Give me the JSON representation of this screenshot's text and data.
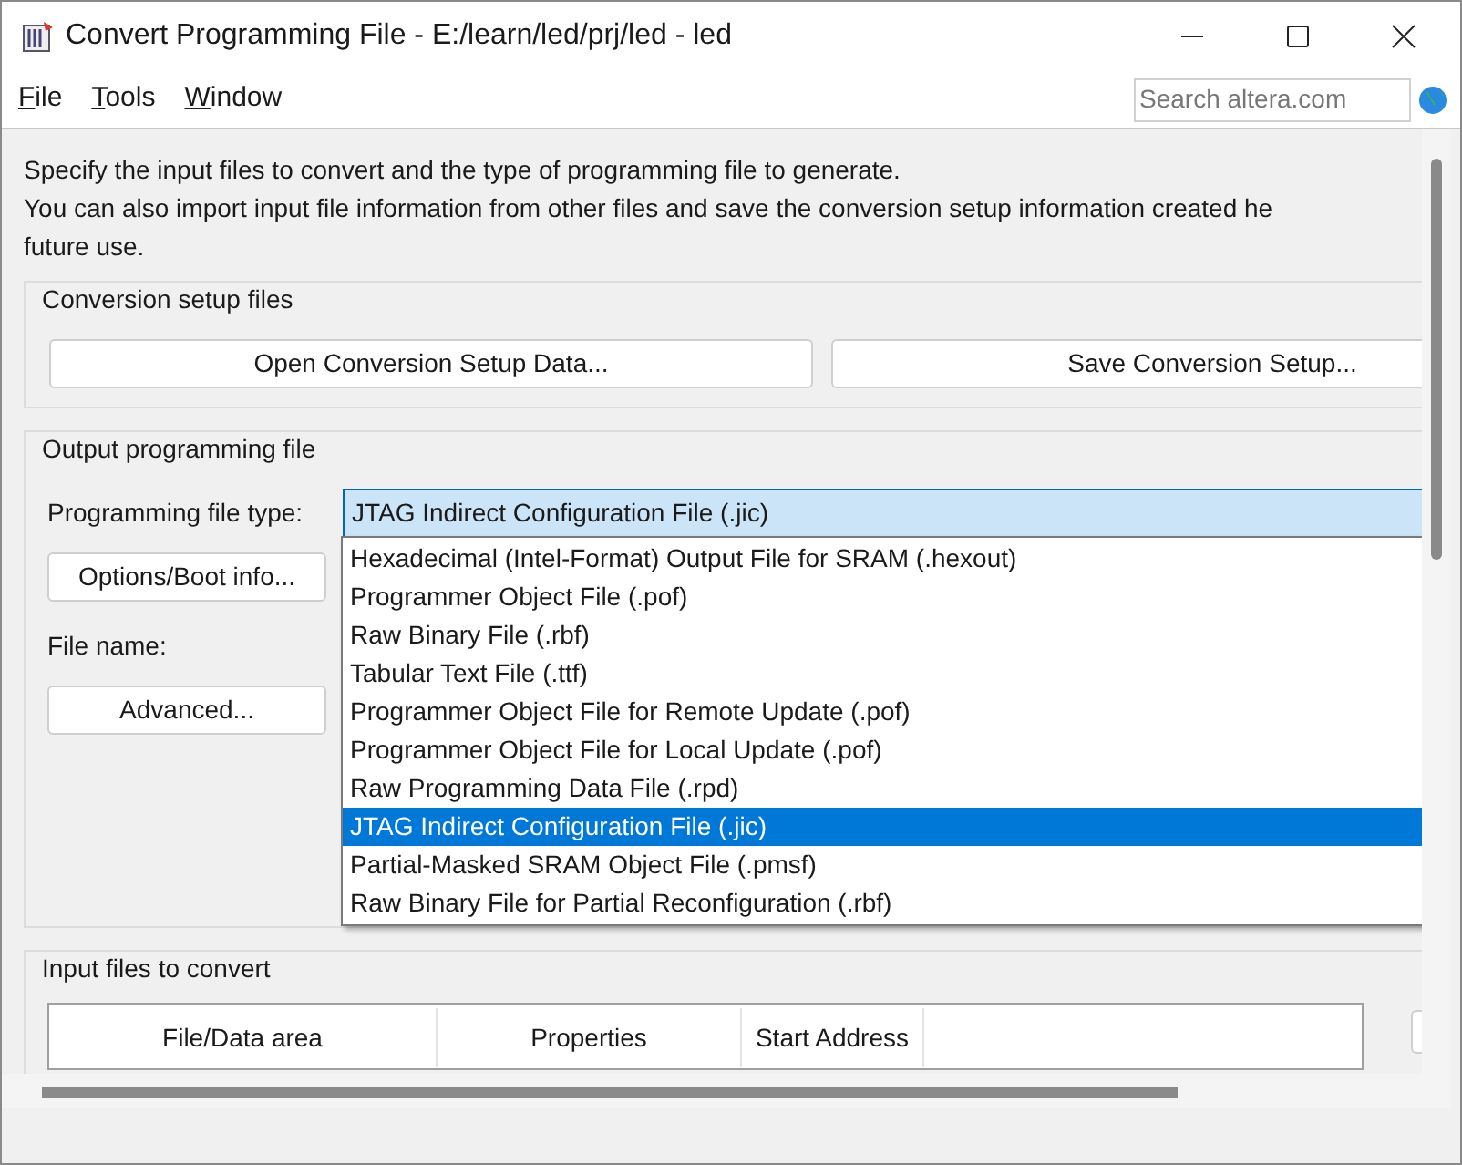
{
  "window": {
    "title": "Convert Programming File - E:/learn/led/prj/led - led"
  },
  "menu": [
    {
      "mnemonic": "F",
      "rest": "ile"
    },
    {
      "mnemonic": "T",
      "rest": "ools"
    },
    {
      "mnemonic": "W",
      "rest": "indow"
    }
  ],
  "search": {
    "placeholder": "Search altera.com"
  },
  "intro_lines": [
    "Specify the input files to convert and the type of programming file to generate.",
    "You can also import input file information from other files and save the conversion setup information created he",
    "future use."
  ],
  "conversion_setup": {
    "title": "Conversion setup files",
    "buttons": [
      "Open Conversion Setup Data...",
      "Save Conversion Setup..."
    ]
  },
  "output": {
    "title": "Output programming file",
    "type_label": "Programming file type:",
    "type_value": "JTAG Indirect Configuration File (.jic)",
    "options_button": "Options/Boot info...",
    "file_name_label": "File name:",
    "advanced_button": "Advanced...",
    "dropdown": [
      {
        "label": "Hexadecimal (Intel-Format) Output File for SRAM (.hexout)",
        "selected": false
      },
      {
        "label": "Programmer Object File (.pof)",
        "selected": false
      },
      {
        "label": "Raw Binary File (.rbf)",
        "selected": false
      },
      {
        "label": "Tabular Text File (.ttf)",
        "selected": false
      },
      {
        "label": "Programmer Object File for Remote Update (.pof)",
        "selected": false
      },
      {
        "label": "Programmer Object File for Local Update (.pof)",
        "selected": false
      },
      {
        "label": "Raw Programming Data File (.rpd)",
        "selected": false
      },
      {
        "label": "JTAG Indirect Configuration File (.jic)",
        "selected": true
      },
      {
        "label": "Partial-Masked SRAM Object File (.pmsf)",
        "selected": false
      },
      {
        "label": "Raw Binary File for Partial Reconfiguration (.rbf)",
        "selected": false
      }
    ]
  },
  "input_files": {
    "title": "Input files to convert",
    "columns": [
      "File/Data area",
      "Properties",
      "Start Address"
    ]
  }
}
